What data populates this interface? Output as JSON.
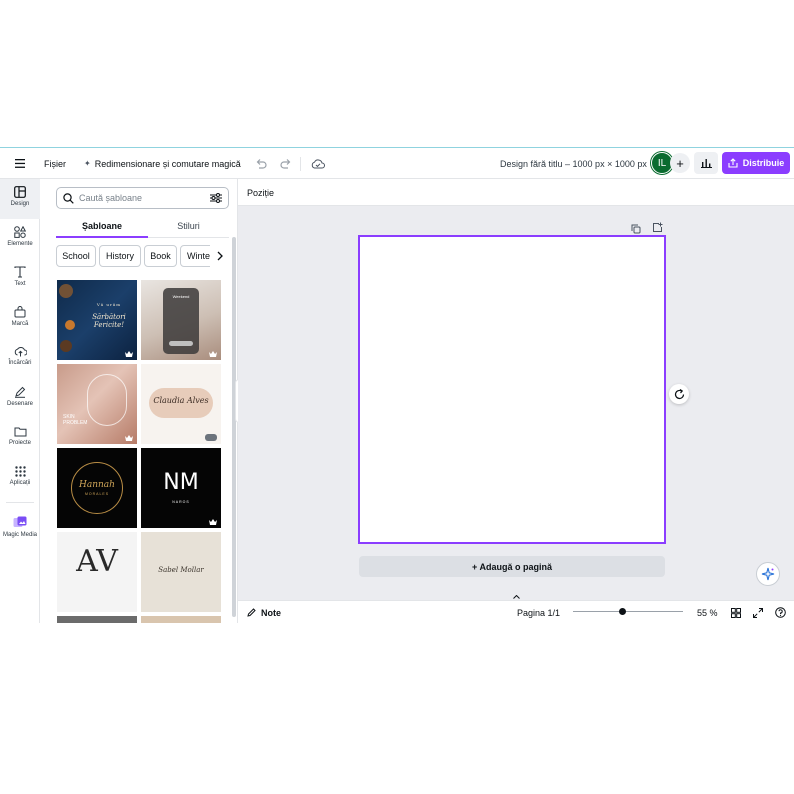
{
  "colors": {
    "accent": "#8b3dff",
    "avatar_bg": "#0a6b30",
    "canvas_bg": "#ebecf0"
  },
  "topbar": {
    "menu_icon": "hamburger-icon",
    "file_label": "Fișier",
    "resize_label": "Redimensionare și comutare magică",
    "undo_icon": "undo-icon",
    "redo_icon": "redo-icon",
    "save_icon": "cloud-check-icon",
    "title": "Design fără titlu – 1000 px × 1000 px",
    "avatar_initials": "IL",
    "share_label": "Distribuie"
  },
  "rail": {
    "items": [
      {
        "label": "Design",
        "icon": "layout-icon"
      },
      {
        "label": "Elemente",
        "icon": "shapes-icon"
      },
      {
        "label": "Text",
        "icon": "text-icon"
      },
      {
        "label": "Marcă",
        "icon": "brand-icon"
      },
      {
        "label": "Încărcări",
        "icon": "upload-cloud-icon"
      },
      {
        "label": "Desenare",
        "icon": "pen-icon"
      },
      {
        "label": "Proiecte",
        "icon": "folder-icon"
      },
      {
        "label": "Aplicații",
        "icon": "apps-grid-icon"
      },
      {
        "label": "Magic Media",
        "icon": "magic-media-icon"
      }
    ]
  },
  "panel": {
    "search_placeholder": "Caută șabloane",
    "tabs": [
      "Șabloane",
      "Stiluri"
    ],
    "chips": [
      "School",
      "History",
      "Book",
      "Winter"
    ],
    "templates": [
      {
        "lines": [
          "Vă urăm",
          "Sărbători",
          "Fericite!"
        ]
      },
      {
        "lines": [
          "Weekend"
        ]
      },
      {
        "lines": [
          "SKIN",
          "PROBLEM"
        ]
      },
      {
        "lines": [
          "Claudia Alves"
        ]
      },
      {
        "lines": [
          "Hannah",
          "MORALES"
        ]
      },
      {
        "lines": [
          "NM",
          "NAROS"
        ]
      },
      {
        "lines": [
          "AV"
        ]
      },
      {
        "lines": [
          "Sabel Mollar"
        ]
      }
    ]
  },
  "editor": {
    "position_label": "Poziție",
    "add_page_label": "+ Adaugă o pagină",
    "notes_label": "Note",
    "page_label": "Pagina 1/1",
    "zoom_label": "55 %",
    "zoom_fraction": 0.45
  }
}
